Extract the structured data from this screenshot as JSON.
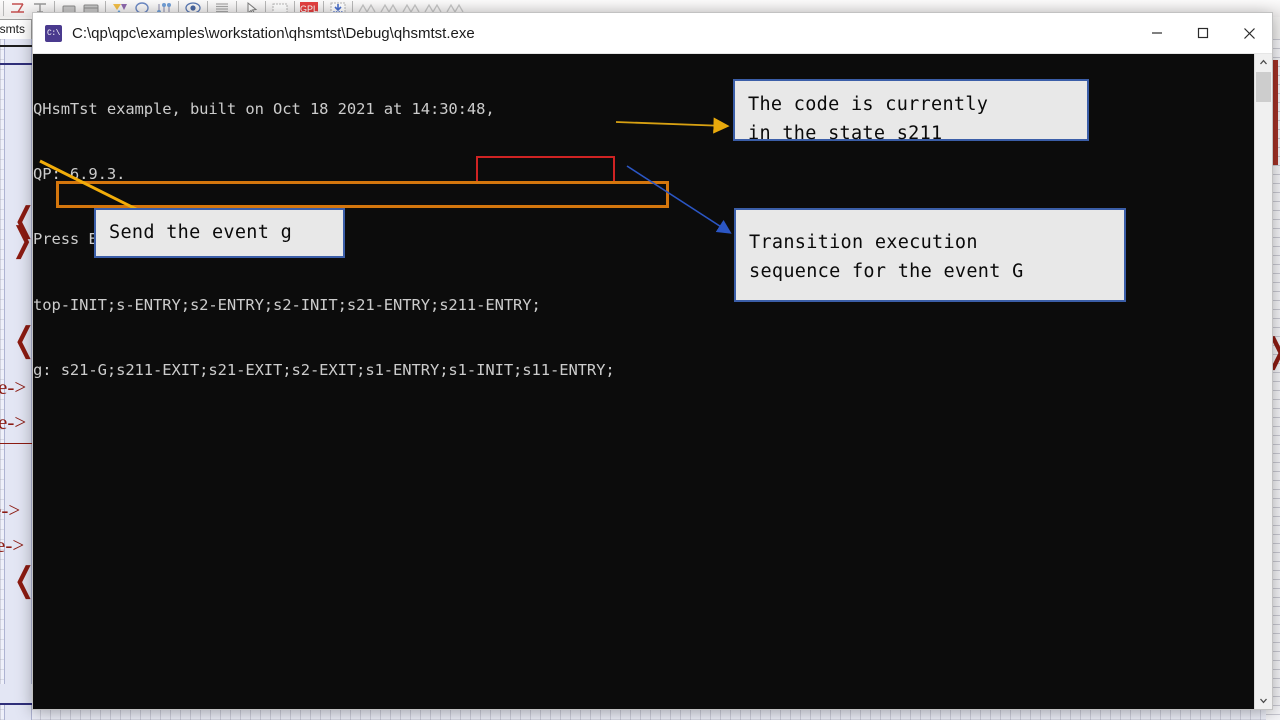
{
  "background_app": {
    "tab_label": "hsmts",
    "toolbar_icons": [
      "arrow-tool-icon",
      "frame-tool-icon",
      "state-tool-icon",
      "composite-state-icon",
      "pin-tool-icon",
      "junction-icon",
      "choice-icon",
      "oval-tool-icon",
      "fork-tool-icon",
      "eye-icon",
      "lines-icon",
      "cursor-icon",
      "table-icon",
      "gpl-logo-icon",
      "download-icon",
      "signal-icon"
    ],
    "diagram_labels": [
      "e->",
      "e->",
      "e->",
      "e->"
    ]
  },
  "window": {
    "app_icon": "console-app-icon",
    "title": "C:\\qp\\qpc\\examples\\workstation\\qhsmtst\\Debug\\qhsmtst.exe",
    "controls": {
      "minimize": "minimize-button",
      "maximize": "maximize-button",
      "close": "close-button"
    },
    "scrollbar": {
      "up_arrow": "⌃",
      "down_arrow": "⌄"
    }
  },
  "console": {
    "background_color": "#0c0c0c",
    "text_color": "#cccccc",
    "lines": [
      "QHsmTst example, built on Oct 18 2021 at 14:30:48,",
      "QP: 6.9.3.",
      "Press ESC to quit...",
      "top-INIT;s-ENTRY;s2-ENTRY;s2-INIT;s21-ENTRY;s211-ENTRY;",
      "g: s21-G;s211-EXIT;s21-EXIT;s2-EXIT;s1-ENTRY;s1-INIT;s11-ENTRY;"
    ]
  },
  "highlights": [
    {
      "name": "state-entry-highlight",
      "color": "#cf2323",
      "target": "s211-ENTRY;"
    },
    {
      "name": "transition-sequence-highlight",
      "color": "#d4760d",
      "target": "s21-G;s211-EXIT;s21-EXIT;s2-EXIT;s1-ENTRY;s1-INIT;s11-ENTRY;"
    }
  ],
  "callouts": [
    {
      "name": "current-state-callout",
      "text": "The code is currently\nin the state s211",
      "border_color": "#3b5ea8",
      "fill_color": "#e8e8e8",
      "arrow_color": "#d49a10"
    },
    {
      "name": "send-event-callout",
      "text": "Send the event g",
      "border_color": "#3b5ea8",
      "fill_color": "#e8e8e8",
      "arrow_color": "#f0a80c"
    },
    {
      "name": "transition-sequence-callout",
      "text": "Transition execution\nsequence for the event G",
      "border_color": "#3b5ea8",
      "fill_color": "#e8e8e8",
      "arrow_color": "#2b56c4"
    }
  ]
}
